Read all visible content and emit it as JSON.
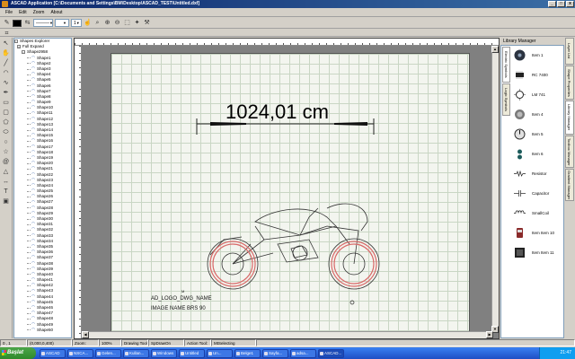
{
  "window": {
    "title": "ASCAD Application [C:\\Documents and Settings\\BM\\Desktop\\ASCAD_TEST\\Untitled.dxf]",
    "controls": [
      "_",
      "□",
      "x"
    ]
  },
  "menu": [
    "File",
    "Edit",
    "Zoom",
    "About"
  ],
  "toolbar": {
    "colors": {
      "primary": "#000000",
      "secondary": "#ffffff"
    },
    "line_style": "———",
    "line_width": "1"
  },
  "explorer": {
    "root": "Shapes Explorer",
    "expand": "Full Expand",
    "group": "Shape2958",
    "items": [
      "Shape1",
      "Shape2",
      "Shape3",
      "Shape4",
      "Shape5",
      "Shape6",
      "Shape7",
      "Shape8",
      "Shape9",
      "Shape10",
      "Shape11",
      "Shape12",
      "Shape13",
      "Shape14",
      "Shape15",
      "Shape16",
      "Shape17",
      "Shape18",
      "Shape19",
      "Shape20",
      "Shape21",
      "Shape22",
      "Shape23",
      "Shape24",
      "Shape25",
      "Shape26",
      "Shape27",
      "Shape28",
      "Shape29",
      "Shape30",
      "Shape31",
      "Shape32",
      "Shape33",
      "Shape34",
      "Shape35",
      "Shape36",
      "Shape37",
      "Shape38",
      "Shape39",
      "Shape40",
      "Shape41",
      "Shape42",
      "Shape43",
      "Shape44",
      "Shape45",
      "Shape46",
      "Shape47",
      "Shape48",
      "Shape49",
      "Shape50"
    ]
  },
  "drawing": {
    "dimension_text": "1024,01 cm",
    "label_1": "AD_LOGO_DWG_NAME",
    "label_2": "IMAGE NAME BRS 90",
    "label_3": "M"
  },
  "library": {
    "title": "Library Manager",
    "tabs": [
      "Electric Symbols",
      "Logic Symbols"
    ],
    "items": [
      {
        "label": "Item 1"
      },
      {
        "label": "RC 7400"
      },
      {
        "label": "LM 741"
      },
      {
        "label": "Item 4"
      },
      {
        "label": "Item 5"
      },
      {
        "label": "Item 6"
      },
      {
        "label": "Resistor"
      },
      {
        "label": "Capacitor"
      },
      {
        "label": "SmallCoil"
      },
      {
        "label": "Item Item 10"
      },
      {
        "label": "Item Item 11"
      }
    ]
  },
  "side_tabs": [
    "Layer List",
    "Shape Properties",
    "Library Manager",
    "Toolbox Manager",
    "Gradient Manager"
  ],
  "status": {
    "coords": "0 , 1",
    "pos": "(0,000,0,400)",
    "zoom_label": "Zoom:",
    "zoom": "100%",
    "tool_label": "Drawing Tool:",
    "tool": "SpDrawOn",
    "action_label": "Action Tool:",
    "action": "MtSelecting"
  },
  "taskbar": {
    "start": "Başlat",
    "tasks": [
      "ASCAD",
      "NSCA...",
      "Gelen...",
      "Kullan...",
      "Windows",
      "Untitled",
      "Un...",
      "Belge1",
      "Sayfa...",
      "adsa...",
      "ASCAD..."
    ],
    "time": "21:47"
  }
}
